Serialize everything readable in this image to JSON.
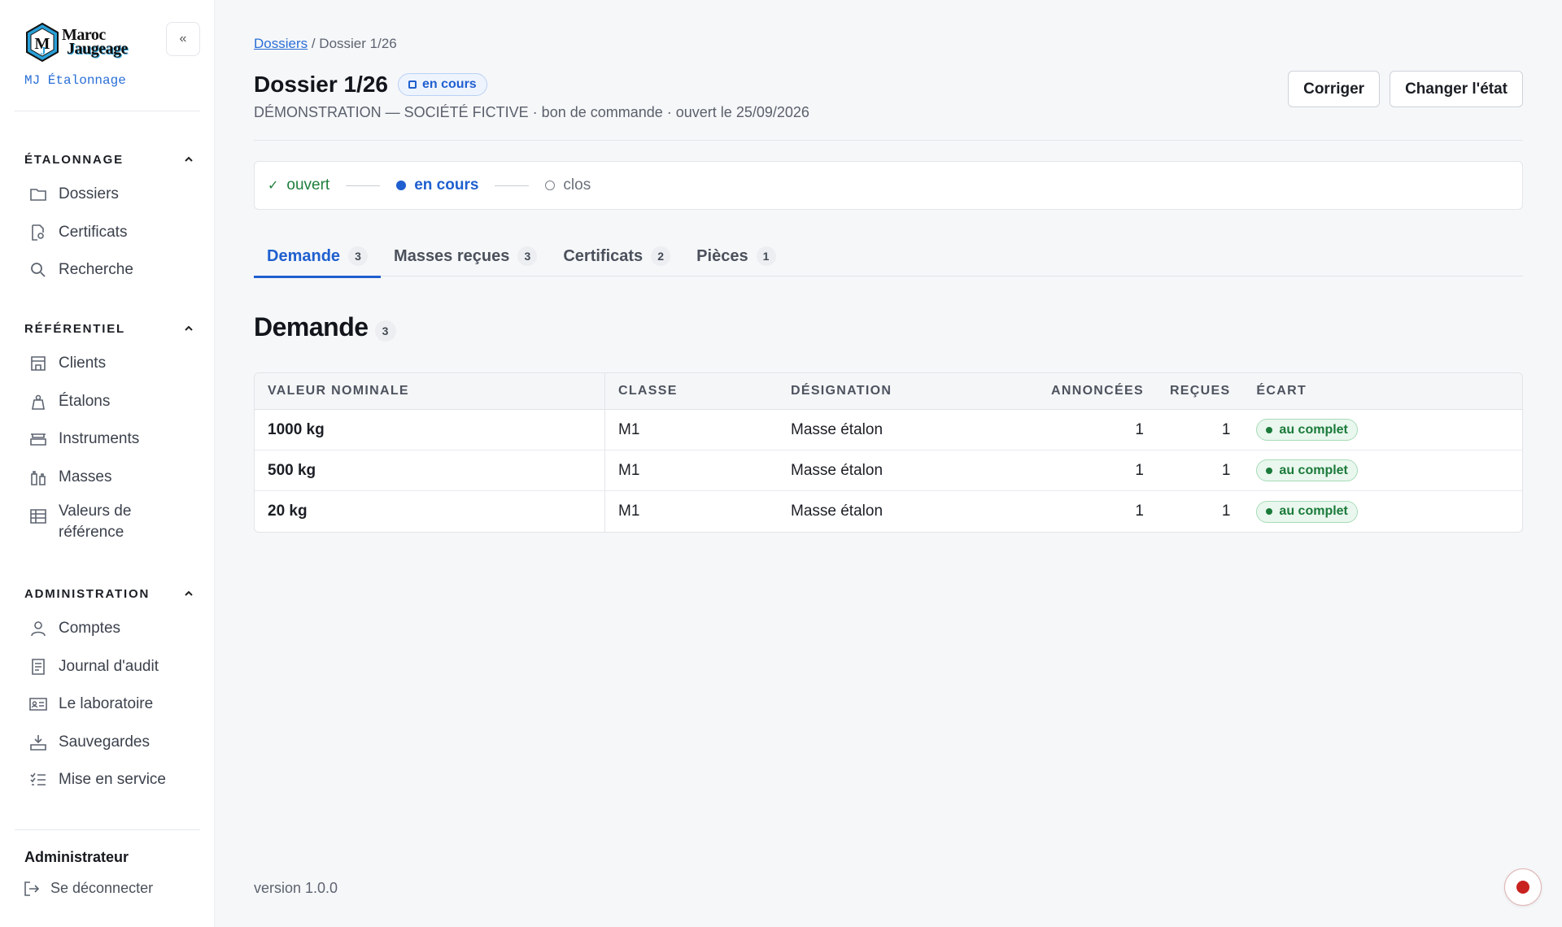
{
  "brand": {
    "logo_line1": "Maroc",
    "logo_line2": "Jaugeage",
    "app_name": "MJ Étalonnage",
    "collapse_label": "«"
  },
  "sidebar": {
    "sections": [
      {
        "title": "ÉTALONNAGE",
        "items": [
          {
            "label": "Dossiers",
            "icon": "folder-icon"
          },
          {
            "label": "Certificats",
            "icon": "certificate-icon"
          },
          {
            "label": "Recherche",
            "icon": "search-icon"
          }
        ]
      },
      {
        "title": "RÉFÉRENTIEL",
        "items": [
          {
            "label": "Clients",
            "icon": "building-icon"
          },
          {
            "label": "Étalons",
            "icon": "weight-icon"
          },
          {
            "label": "Instruments",
            "icon": "scale-icon"
          },
          {
            "label": "Masses",
            "icon": "masses-icon"
          },
          {
            "label": "Valeurs de référence",
            "icon": "table-icon"
          }
        ]
      },
      {
        "title": "ADMINISTRATION",
        "items": [
          {
            "label": "Comptes",
            "icon": "user-icon"
          },
          {
            "label": "Journal d'audit",
            "icon": "journal-icon"
          },
          {
            "label": "Le laboratoire",
            "icon": "id-card-icon"
          },
          {
            "label": "Sauvegardes",
            "icon": "download-icon"
          },
          {
            "label": "Mise en service",
            "icon": "checklist-icon"
          }
        ]
      }
    ],
    "user_name": "Administrateur",
    "logout_label": "Se déconnecter"
  },
  "page": {
    "breadcrumb_link": "Dossiers",
    "breadcrumb_sep": " / ",
    "breadcrumb_current": "Dossier 1/26",
    "title": "Dossier 1/26",
    "state_badge": "en cours",
    "subtitle": "DÉMONSTRATION — SOCIÉTÉ FICTIVE · bon de commande · ouvert le 25/09/2026",
    "actions": {
      "correct": "Corriger",
      "change_state": "Changer l'état"
    }
  },
  "stepper": {
    "done": "ouvert",
    "active": "en cours",
    "todo": "clos",
    "check": "✓"
  },
  "tabs": [
    {
      "label": "Demande",
      "count": "3"
    },
    {
      "label": "Masses reçues",
      "count": "3"
    },
    {
      "label": "Certificats",
      "count": "2"
    },
    {
      "label": "Pièces",
      "count": "1"
    }
  ],
  "section": {
    "title": "Demande",
    "count": "3"
  },
  "table": {
    "headers": [
      "VALEUR NOMINALE",
      "CLASSE",
      "DÉSIGNATION",
      "ANNONCÉES",
      "REÇUES",
      "ÉCART"
    ],
    "rows": [
      {
        "nominal": "1000 kg",
        "classe": "M1",
        "designation": "Masse étalon",
        "annoncees": "1",
        "recues": "1",
        "ecart": "au complet"
      },
      {
        "nominal": "500 kg",
        "classe": "M1",
        "designation": "Masse étalon",
        "annoncees": "1",
        "recues": "1",
        "ecart": "au complet"
      },
      {
        "nominal": "20 kg",
        "classe": "M1",
        "designation": "Masse étalon",
        "annoncees": "1",
        "recues": "1",
        "ecart": "au complet"
      }
    ]
  },
  "footer": {
    "version": "version 1.0.0"
  },
  "colors": {
    "accent": "#1f5fcf",
    "success": "#1b7a3a",
    "record": "#c8221f"
  }
}
